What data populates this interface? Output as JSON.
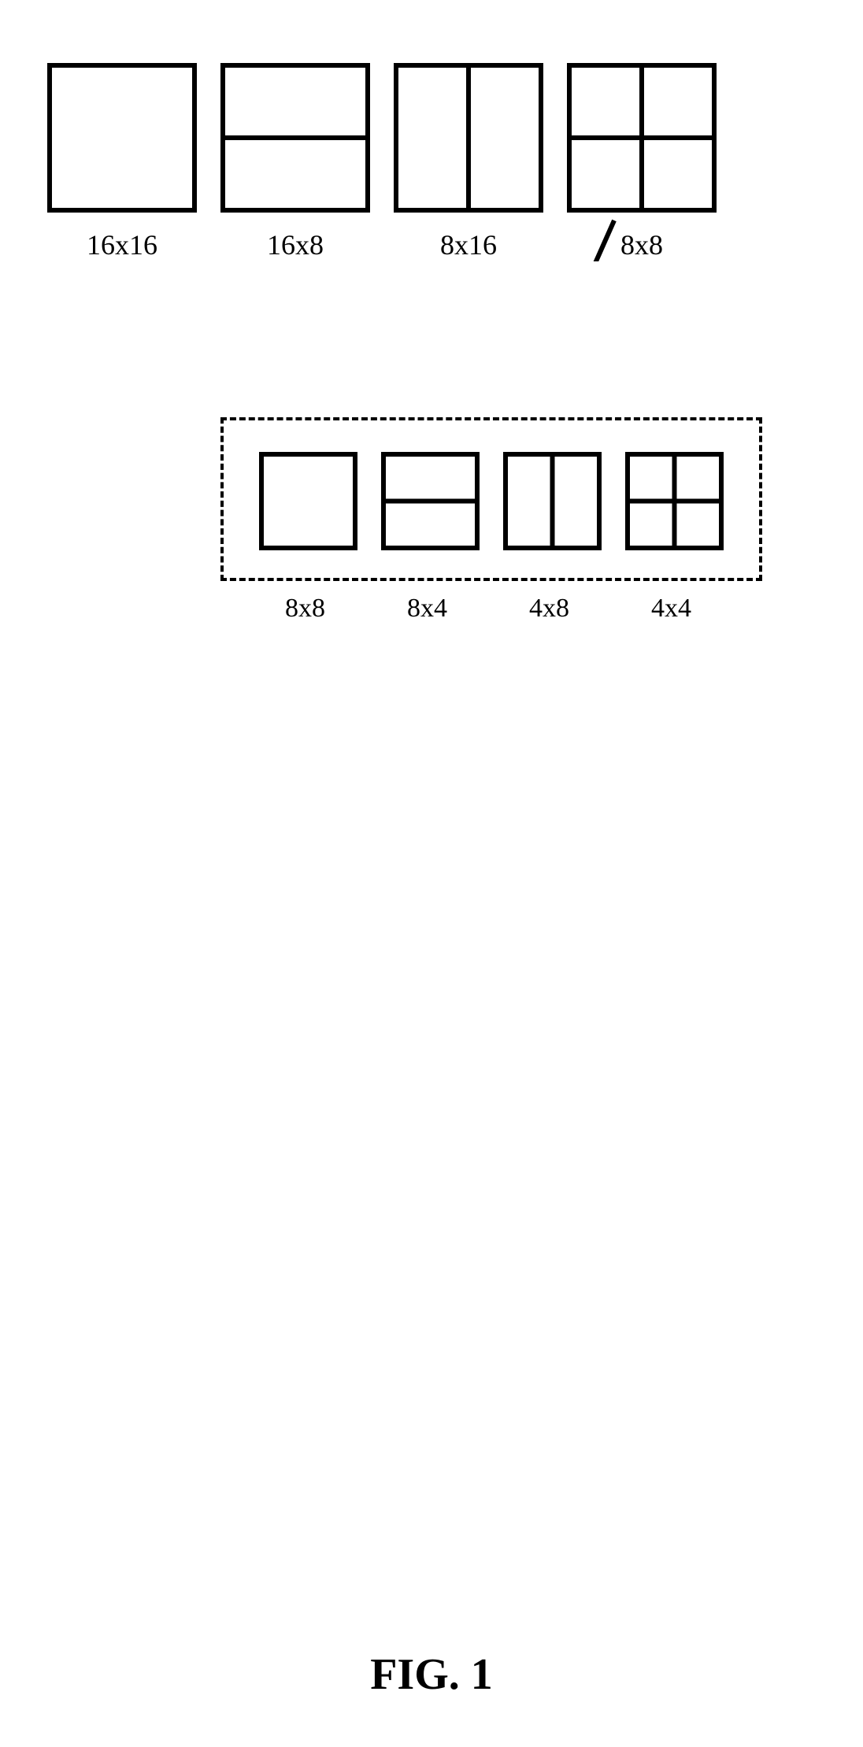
{
  "top": {
    "b1": "16x16",
    "b2": "16x8",
    "b3": "8x16",
    "b4": "8x8"
  },
  "sub": {
    "s1": "8x8",
    "s2": "8x4",
    "s3": "4x8",
    "s4": "4x4"
  },
  "caption": "FIG. 1"
}
